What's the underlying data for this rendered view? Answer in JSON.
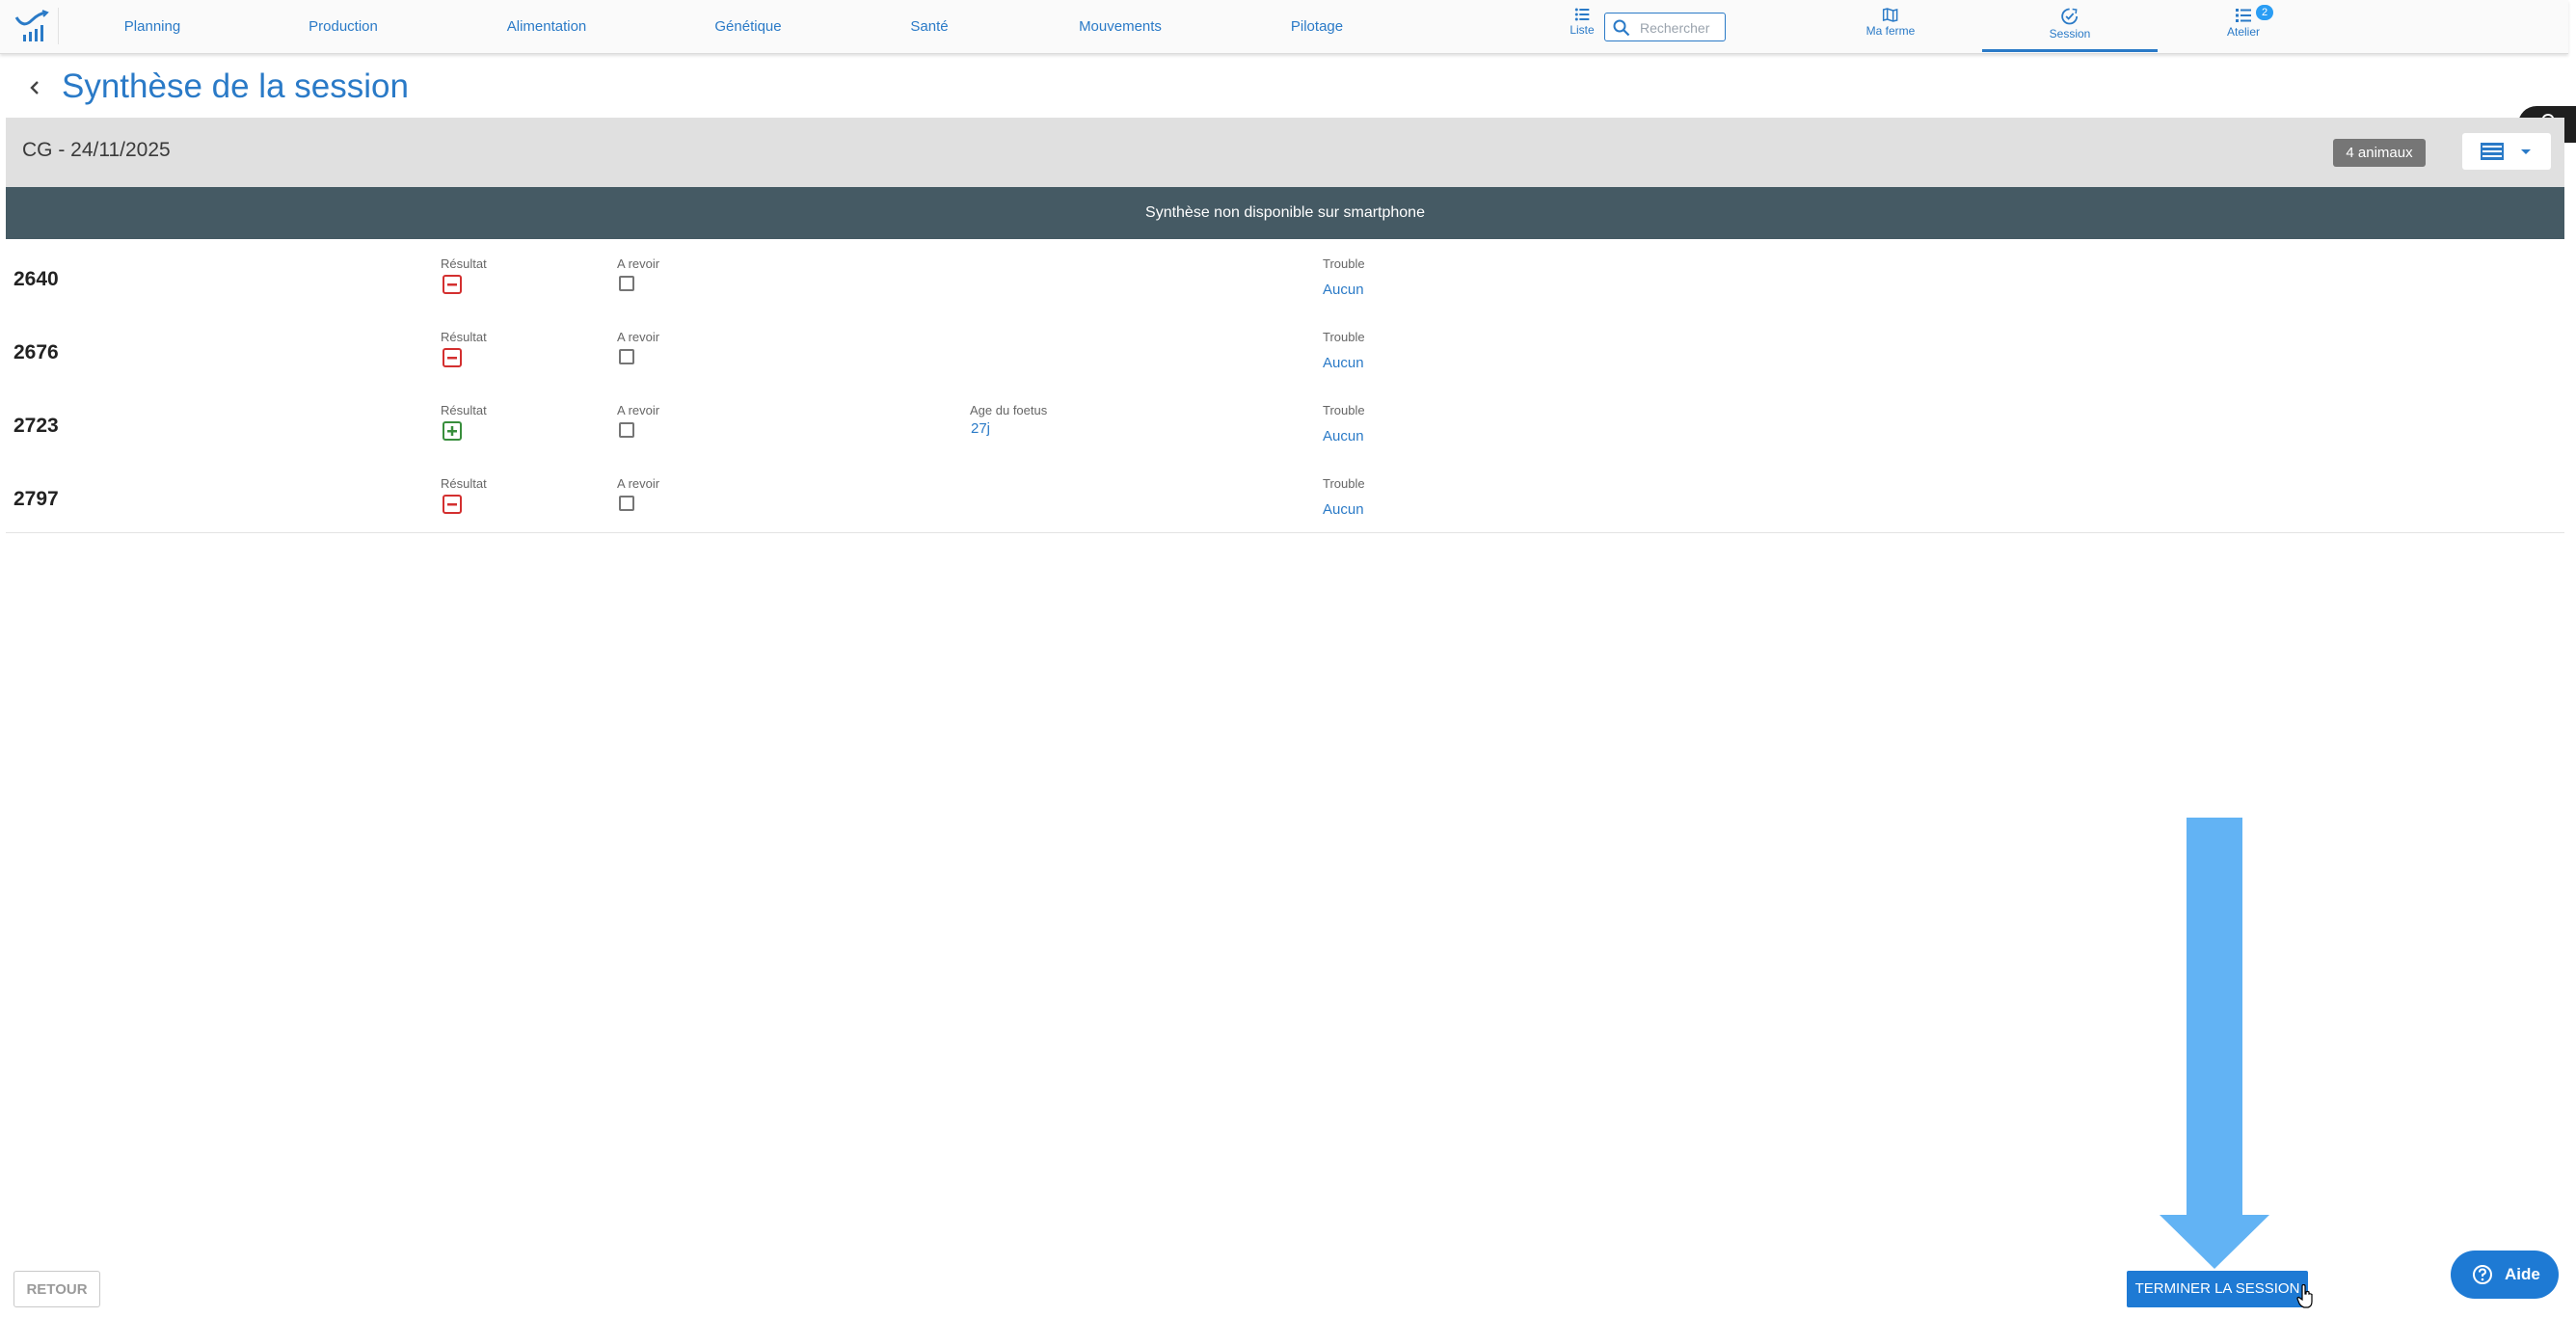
{
  "nav": {
    "items": [
      "Planning",
      "Production",
      "Alimentation",
      "Génétique",
      "Santé",
      "Mouvements",
      "Pilotage"
    ],
    "liste_label": "Liste",
    "search_placeholder": "Rechercher",
    "ma_ferme_label": "Ma ferme",
    "session_label": "Session",
    "atelier_label": "Atelier",
    "atelier_badge": "2",
    "active": "Session"
  },
  "page": {
    "title": "Synthèse de la session"
  },
  "session": {
    "name": "CG - 24/11/2025",
    "count_label": "4 animaux"
  },
  "info_bar": "Synthèse non disponible sur smartphone",
  "labels": {
    "resultat": "Résultat",
    "a_revoir": "A revoir",
    "age_foetus": "Age du foetus",
    "trouble": "Trouble"
  },
  "rows": [
    {
      "id": "2640",
      "result": "negative",
      "a_revoir": false,
      "age_foetus": "",
      "trouble": "Aucun"
    },
    {
      "id": "2676",
      "result": "negative",
      "a_revoir": false,
      "age_foetus": "",
      "trouble": "Aucun"
    },
    {
      "id": "2723",
      "result": "positive",
      "a_revoir": false,
      "age_foetus": "27j",
      "trouble": "Aucun"
    },
    {
      "id": "2797",
      "result": "negative",
      "a_revoir": false,
      "age_foetus": "",
      "trouble": "Aucun"
    }
  ],
  "footer": {
    "retour_label": "RETOUR",
    "terminer_label": "TERMINER LA SESSION",
    "aide_label": "Aide"
  },
  "colors": {
    "accent": "#2a7ac7",
    "info_bar": "#455a64",
    "negative": "#d32f2f",
    "positive": "#388e3c",
    "annotation_arrow": "#62b3f4"
  }
}
